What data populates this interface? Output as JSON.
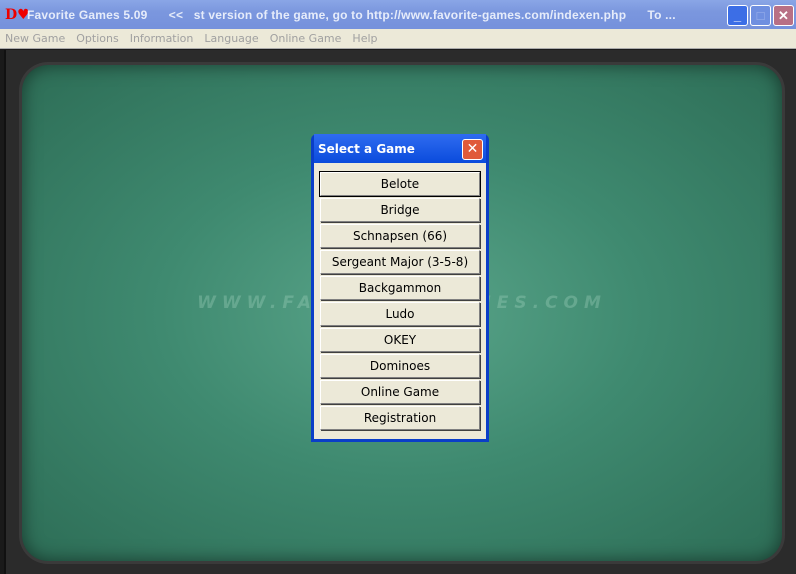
{
  "window": {
    "logo": "D♥",
    "title": "Favorite Games 5.09      <<   st version of the game, go to http://www.favorite-games.com/indexen.php      To ...",
    "minimize": "_",
    "maximize": "□",
    "close": "✕"
  },
  "menu": [
    "New Game",
    "Options",
    "Information",
    "Language",
    "Online Game",
    "Help"
  ],
  "board": {
    "watermark": "WWW.FAVORITE-GAMES.COM"
  },
  "dialog": {
    "title": "Select a Game",
    "close": "✕",
    "games": [
      "Belote",
      "Bridge",
      "Schnapsen (66)",
      "Sergeant Major (3-5-8)",
      "Backgammon",
      "Ludo",
      "OKEY",
      "Dominoes",
      "Online Game",
      "Registration"
    ]
  }
}
